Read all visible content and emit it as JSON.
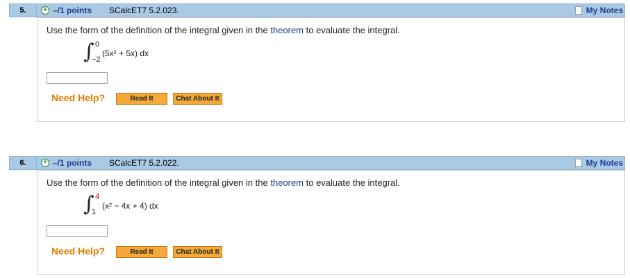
{
  "questions": [
    {
      "number": "5.",
      "points": "–/1 points",
      "code": "SCalcET7 5.2.023.",
      "my_notes": "My Notes",
      "prompt_before": "Use the form of the definition of the integral given in the ",
      "prompt_link": "theorem",
      "prompt_after": " to evaluate the integral.",
      "upper": "0",
      "lower": "−2",
      "integrand": "(5x² + 5x) dx",
      "need_help": "Need Help?",
      "read_it": "Read It",
      "chat_about_it": "Chat About It"
    },
    {
      "number": "6.",
      "points": "–/1 points",
      "code": "SCalcET7 5.2.022.",
      "my_notes": "My Notes",
      "prompt_before": "Use the form of the definition of the integral given in the ",
      "prompt_link": "theorem",
      "prompt_after": " to evaluate the integral.",
      "upper": "4",
      "lower": "1",
      "integrand": "(x² − 4x + 4) dx",
      "need_help": "Need Help?",
      "read_it": "Read It",
      "chat_about_it": "Chat About It"
    }
  ]
}
